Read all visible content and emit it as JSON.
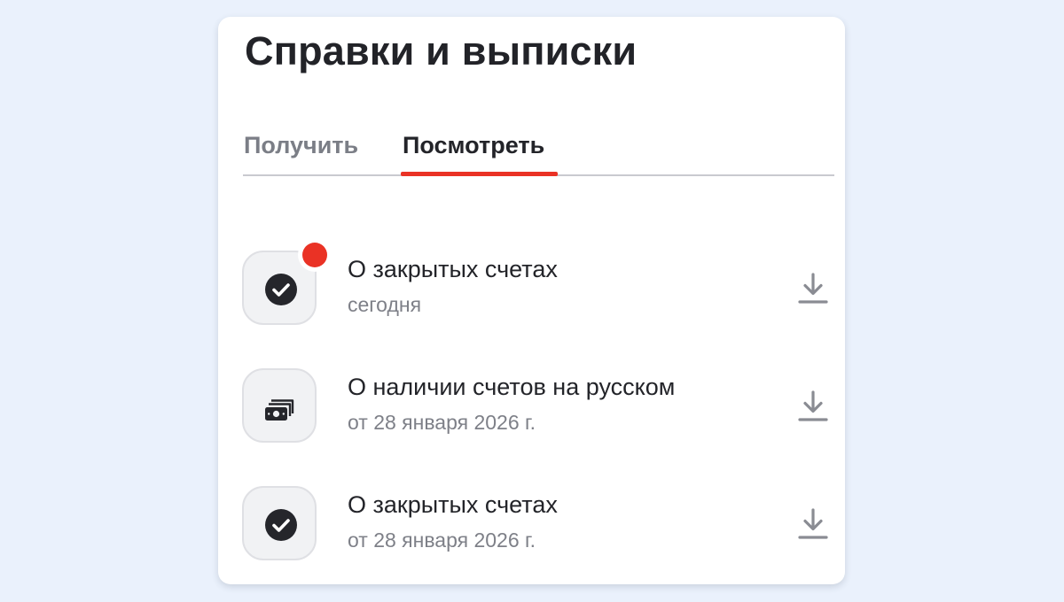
{
  "page": {
    "title": "Справки и выписки"
  },
  "tabs": [
    {
      "label": "Получить",
      "active": false
    },
    {
      "label": "Посмотреть",
      "active": true
    }
  ],
  "documents": [
    {
      "title": "О закрытых счетах",
      "date": "сегодня",
      "icon": "check-circle-icon",
      "unread": true
    },
    {
      "title": "О наличии счетов на русском",
      "date": "от 28 января 2026 г.",
      "icon": "banknotes-icon",
      "unread": false
    },
    {
      "title": "О закрытых счетах",
      "date": "от 28 января 2026 г.",
      "icon": "check-circle-icon",
      "unread": false
    }
  ],
  "colors": {
    "accent": "#ea3225",
    "page_background": "#eaf1fc",
    "card_background": "#ffffff",
    "primary_text": "#232429",
    "secondary_text": "#7e8088",
    "icon_tile": "#f1f2f4"
  }
}
